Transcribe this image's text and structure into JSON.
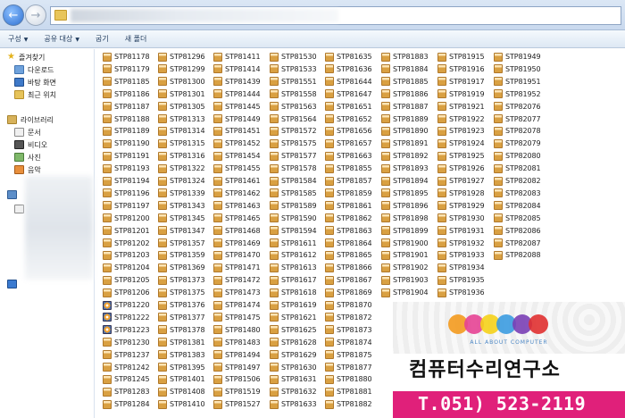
{
  "toolbar": {
    "organize": "구성",
    "share": "공유 대상",
    "burn": "굽기",
    "new_folder": "새 폴더"
  },
  "nav": {
    "favorites": "즐겨찾기",
    "downloads": "다운로드",
    "desktop": "바탕 화면",
    "recent": "최근 위치",
    "libraries": "라이브러리",
    "documents": "문서",
    "videos": "비디오",
    "pictures": "사진",
    "music": "음악"
  },
  "files": {
    "columns": [
      [
        "STP81178",
        "STP81179",
        "STP81185",
        "STP81186",
        "STP81187",
        "STP81188",
        "STP81189",
        "STP81190",
        "STP81191",
        "STP81193",
        "STP81194",
        "STP81196",
        "STP81197",
        "STP81200",
        "STP81201",
        "STP81202",
        "STP81203",
        "STP81204",
        "STP81205",
        "STP81206",
        "STP81220",
        "STP81222",
        "STP81223",
        "STP81230",
        "STP81237",
        "STP81242",
        "STP81245",
        "STP81283",
        "STP81284"
      ],
      [
        "STP81296",
        "STP81299",
        "STP81300",
        "STP81301",
        "STP81305",
        "STP81313",
        "STP81314",
        "STP81315",
        "STP81316",
        "STP81322",
        "STP81324",
        "STP81339",
        "STP81343",
        "STP81345",
        "STP81347",
        "STP81357",
        "STP81359",
        "STP81369",
        "STP81373",
        "STP81375",
        "STP81376",
        "STP81377",
        "STP81378",
        "STP81381",
        "STP81383",
        "STP81395",
        "STP81401",
        "STP81408",
        "STP81410"
      ],
      [
        "STP81411",
        "STP81414",
        "STP81439",
        "STP81444",
        "STP81445",
        "STP81449",
        "STP81451",
        "STP81452",
        "STP81454",
        "STP81455",
        "STP81461",
        "STP81462",
        "STP81463",
        "STP81465",
        "STP81468",
        "STP81469",
        "STP81470",
        "STP81471",
        "STP81472",
        "STP81473",
        "STP81474",
        "STP81475",
        "STP81480",
        "STP81483",
        "STP81494",
        "STP81497",
        "STP81506",
        "STP81519",
        "STP81527"
      ],
      [
        "STP81530",
        "STP81533",
        "STP81551",
        "STP81558",
        "STP81563",
        "STP81564",
        "STP81572",
        "STP81575",
        "STP81577",
        "STP81578",
        "STP81584",
        "STP81585",
        "STP81589",
        "STP81590",
        "STP81594",
        "STP81611",
        "STP81612",
        "STP81613",
        "STP81617",
        "STP81618",
        "STP81619",
        "STP81621",
        "STP81625",
        "STP81628",
        "STP81629",
        "STP81630",
        "STP81631",
        "STP81632",
        "STP81633"
      ],
      [
        "STP81635",
        "STP81636",
        "STP81644",
        "STP81647",
        "STP81651",
        "STP81652",
        "STP81656",
        "STP81657",
        "STP81663",
        "STP81855",
        "STP81857",
        "STP81859",
        "STP81861",
        "STP81862",
        "STP81863",
        "STP81864",
        "STP81865",
        "STP81866",
        "STP81867",
        "STP81869",
        "STP81870",
        "STP81872",
        "STP81873",
        "STP81874",
        "STP81875",
        "STP81877",
        "STP81880",
        "STP81881",
        "STP81882"
      ],
      [
        "STP81883",
        "STP81884",
        "STP81885",
        "STP81886",
        "STP81887",
        "STP81889",
        "STP81890",
        "STP81891",
        "STP81892",
        "STP81893",
        "STP81894",
        "STP81895",
        "STP81896",
        "STP81898",
        "STP81899",
        "STP81900",
        "STP81901",
        "STP81902",
        "STP81903",
        "STP81904"
      ],
      [
        "STP81915",
        "STP81916",
        "STP81917",
        "STP81919",
        "STP81921",
        "STP81922",
        "STP81923",
        "STP81924",
        "STP81925",
        "STP81926",
        "STP81927",
        "STP81928",
        "STP81929",
        "STP81930",
        "STP81931",
        "STP81932",
        "STP81933",
        "STP81934",
        "STP81935",
        "STP81936"
      ],
      [
        "STP81949",
        "STP81950",
        "STP81951",
        "STP81952",
        "STP82076",
        "STP82077",
        "STP82078",
        "STP82079",
        "STP82080",
        "STP82081",
        "STP82082",
        "STP82083",
        "STP82084",
        "STP82085",
        "STP82086",
        "STP82087",
        "STP82088"
      ]
    ]
  },
  "ad": {
    "tagline": "ALL ABOUT COMPUTER",
    "title": "컴퓨터수리연구소",
    "phone": "T.051) 523-2119",
    "dot_colors": [
      "#f39a1e",
      "#e64393",
      "#f5d21a",
      "#3b9be0",
      "#7a3fb5",
      "#e03030"
    ]
  }
}
